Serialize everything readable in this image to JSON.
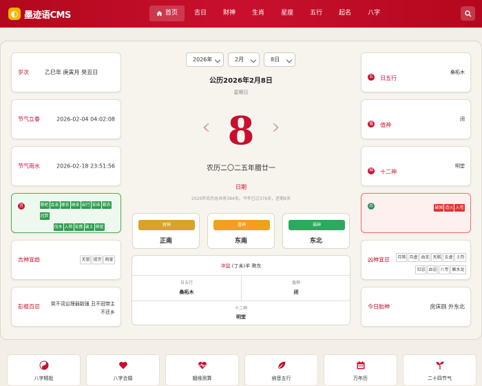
{
  "header": {
    "logo_badge": "◐",
    "brand": "墨迹语CMS",
    "nav": [
      {
        "label": "首页",
        "active": true
      },
      {
        "label": "吉日"
      },
      {
        "label": "财神"
      },
      {
        "label": "生肖"
      },
      {
        "label": "星座"
      },
      {
        "label": "五行"
      },
      {
        "label": "起名"
      },
      {
        "label": "八字"
      }
    ]
  },
  "selectors": {
    "year": "2026年",
    "month": "2月",
    "day": "8日"
  },
  "date": {
    "solar": "公历2026年2月8日",
    "weekday": "星期日",
    "day_number": "8",
    "lunar": "农历二〇二五年腊廿一",
    "ri_title": "日期",
    "ri_info": "2026年农历总共有384天。今年已过376天，还剩8天"
  },
  "left": {
    "suici": {
      "label": "岁次",
      "value": "乙巳年 庚寅月 癸丑日"
    },
    "jieqi1": {
      "label": "节气立春",
      "value": "2026-02-04 04:02:08"
    },
    "jieqi2": {
      "label": "节气雨水",
      "value": "2026-02-18 23:51:56"
    },
    "yi": {
      "badge": "宜",
      "row1": [
        "祭祀",
        "会亲",
        "嫁衣",
        "纳采",
        "出行",
        "安床",
        "裁衣",
        "冠笄"
      ],
      "row2": [
        "伐木",
        "入殓",
        "安葬",
        "破土",
        "移徙"
      ]
    },
    "jishen": {
      "label": "吉神宜趋",
      "tags": [
        "天恩",
        "续世",
        "明堂"
      ]
    },
    "pengzu": {
      "label": "彭祖百忌",
      "value1": "癸不词讼理弱敌强 丑不冠带主",
      "value2": "不还乡"
    }
  },
  "gods": [
    {
      "label": "财神",
      "dir": "正南",
      "color": "#d9a22a"
    },
    {
      "label": "喜神",
      "dir": "东南",
      "color": "#f0a020"
    },
    {
      "label": "福神",
      "dir": "东北",
      "color": "#2ea85e"
    }
  ],
  "chong": {
    "label": "冲鼠",
    "detail": "(丁未)羊 煞东",
    "wuxing_label": "日五行",
    "wuxing_value": "桑柘木",
    "zhishen_label": "值神",
    "zhishen_value": "闭",
    "shishen_label": "十二神",
    "shishen_value": "明堂"
  },
  "right": {
    "wuxing": {
      "label": "日五行",
      "value": "桑柘木",
      "badge": "五"
    },
    "zhishen": {
      "label": "值神",
      "value": "闭",
      "badge": "值"
    },
    "shier": {
      "label": "十二神",
      "value": "明堂",
      "badge": "神"
    },
    "ji": {
      "badge": "忌",
      "tags": [
        "破固",
        "造火",
        "入宅"
      ]
    },
    "xiongsha": {
      "label": "凶神宜忌",
      "row1": [
        "月煞",
        "月虚",
        "血支",
        "天贼",
        "五虚",
        "土符"
      ],
      "row2": [
        "归忌",
        "血忌",
        "八专",
        "触水龙"
      ]
    },
    "taishen": {
      "label": "今日胎神",
      "value": "房床厕 外东北"
    }
  },
  "shortcuts": [
    {
      "label": "八字精批",
      "icon": "yinyang-icon"
    },
    {
      "label": "八字合婚",
      "icon": "heart-icon"
    },
    {
      "label": "姻缘测算",
      "icon": "heartbeat-icon"
    },
    {
      "label": "纳音五行",
      "icon": "leaf-icon"
    },
    {
      "label": "万年历",
      "icon": "calendar-icon"
    },
    {
      "label": "二十四节气",
      "icon": "sprout-icon"
    }
  ],
  "colors": {
    "brand": "#c8102e",
    "yi_green": "#2e9e4f",
    "ji_red": "#e0312f"
  }
}
